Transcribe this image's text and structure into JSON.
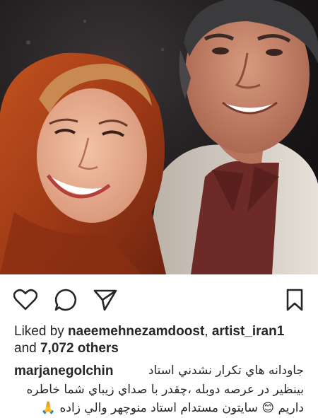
{
  "post": {
    "photo_alt": "",
    "actions": {
      "like_icon": "heart-outline-icon",
      "comment_icon": "comment-bubble-icon",
      "share_icon": "paper-plane-icon",
      "save_icon": "bookmark-icon"
    },
    "likes": {
      "prefix": "Liked by ",
      "user1": "naeemehnezamdoost",
      "separator": ", ",
      "user2": "artist_iran1",
      "and_text": "and ",
      "others_count": "7,072 others"
    },
    "caption": {
      "username": "marjanegolchin",
      "line1": "جاودانه هاي تكرار نشدني استاد",
      "line2": "بينظير در عرصه دوبله ،چقدر با صداي زيباي شما خاطره",
      "line3": "داريم 😊 سايتون مستدام استاد منوچهر والي زاده 🙏"
    },
    "colors": {
      "text": "#262626",
      "background": "#ffffff"
    }
  }
}
